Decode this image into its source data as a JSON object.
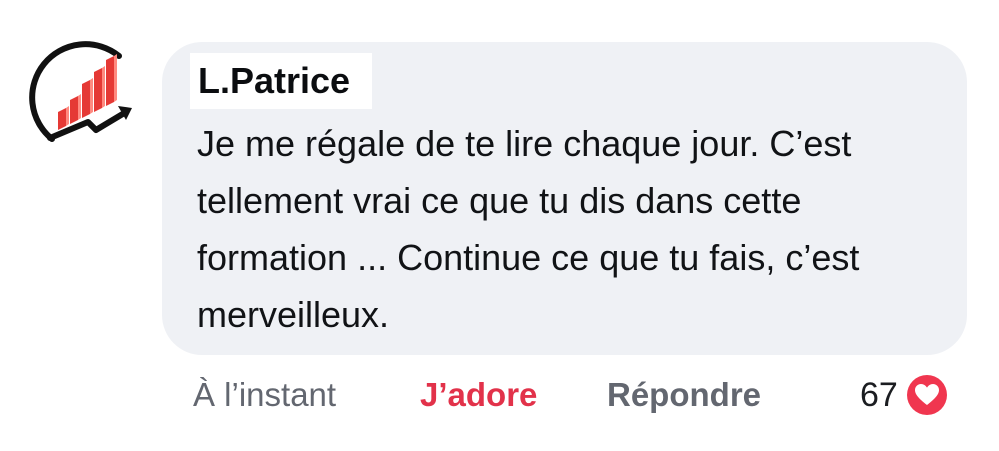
{
  "comment": {
    "author": "L.Patrice",
    "text": "Je me régale de te lire chaque jour. C’est tellement vrai ce que tu dis dans cette formation ... Continue ce que tu fais, c’est merveilleux.",
    "timestamp": "À l’instant",
    "love_label": "J’adore",
    "reply_label": "Répondre",
    "reaction_count": "67",
    "reaction_icon": "heart-icon"
  },
  "colors": {
    "bubble": "#eff1f5",
    "love": "#e2324a",
    "muted": "#636770",
    "reaction_badge": "#f0364f"
  }
}
